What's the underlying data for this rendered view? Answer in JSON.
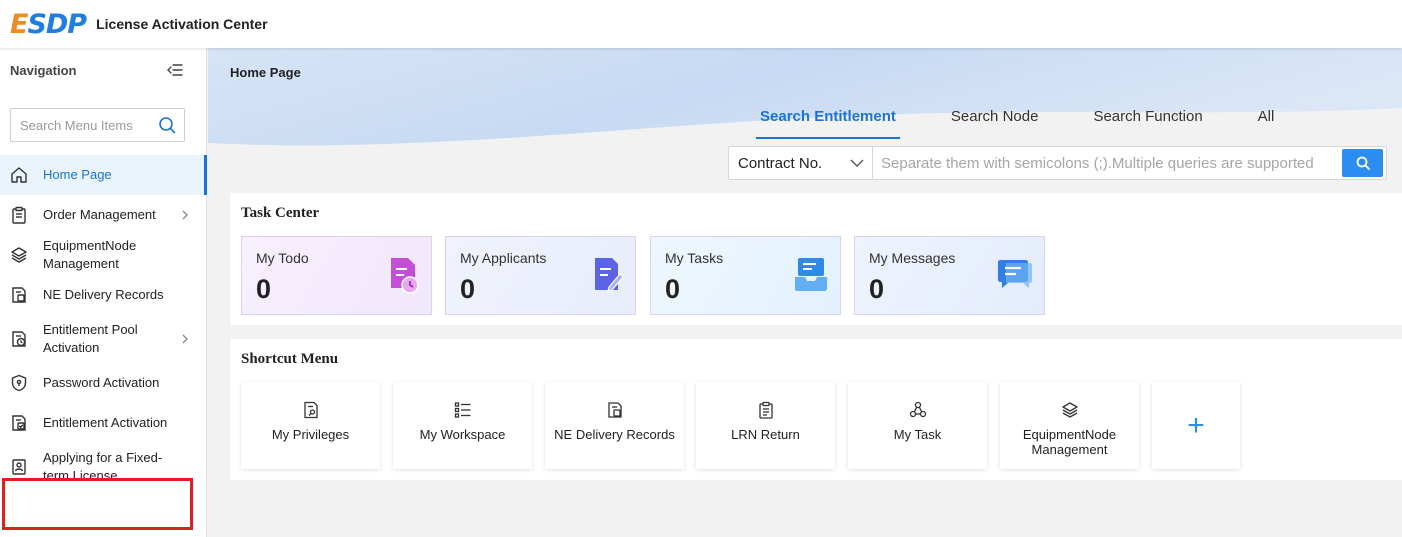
{
  "app": {
    "logo_main": "ESDP",
    "title": "License Activation Center"
  },
  "sidebar": {
    "title": "Navigation",
    "search_placeholder": "Search Menu Items",
    "items": [
      {
        "label": "Home Page",
        "icon": "home-icon",
        "active": true
      },
      {
        "label": "Order Management",
        "icon": "clipboard-icon",
        "has_children": true
      },
      {
        "label": "EquipmentNode Management",
        "icon": "layers-icon"
      },
      {
        "label": "NE Delivery Records",
        "icon": "document-icon"
      },
      {
        "label": "Entitlement Pool Activation",
        "icon": "document-clock-icon",
        "has_children": true
      },
      {
        "label": "Password Activation",
        "icon": "shield-icon"
      },
      {
        "label": "Entitlement Activation",
        "icon": "document-check-icon"
      },
      {
        "label": "Applying for a Fixed-term License",
        "icon": "id-card-icon",
        "highlighted": true
      }
    ]
  },
  "main": {
    "breadcrumb": "Home Page",
    "tabs": [
      "Search Entitlement",
      "Search Node",
      "Search Function",
      "All"
    ],
    "active_tab": "Search Entitlement",
    "query": {
      "select_value": "Contract No.",
      "placeholder": "Separate them with semicolons (;).Multiple queries are supported"
    },
    "task_center": {
      "title": "Task Center",
      "cards": [
        {
          "label": "My Todo",
          "count": "0",
          "icon": "todo-clock-icon",
          "color": "#c34fd6"
        },
        {
          "label": "My Applicants",
          "count": "0",
          "icon": "edit-document-icon",
          "color": "#5b63e6"
        },
        {
          "label": "My Tasks",
          "count": "0",
          "icon": "inbox-tray-icon",
          "color": "#2f8ae6"
        },
        {
          "label": "My Messages",
          "count": "0",
          "icon": "chat-bubble-icon",
          "color": "#2f7fe6"
        }
      ]
    },
    "shortcut_menu": {
      "title": "Shortcut Menu",
      "items": [
        {
          "label": "My Privileges",
          "icon": "document-key-icon"
        },
        {
          "label": "My Workspace",
          "icon": "list-check-icon"
        },
        {
          "label": "NE Delivery Records",
          "icon": "document-icon"
        },
        {
          "label": "LRN Return",
          "icon": "clipboard-icon"
        },
        {
          "label": "My Task",
          "icon": "nodes-icon"
        },
        {
          "label": "EquipmentNode Management",
          "icon": "layers-icon"
        }
      ],
      "add_label": "+"
    }
  },
  "colors": {
    "primary": "#1a73d8",
    "button": "#2d8cf0",
    "logo_accent": "#f08a24",
    "highlight": "#e02020"
  }
}
